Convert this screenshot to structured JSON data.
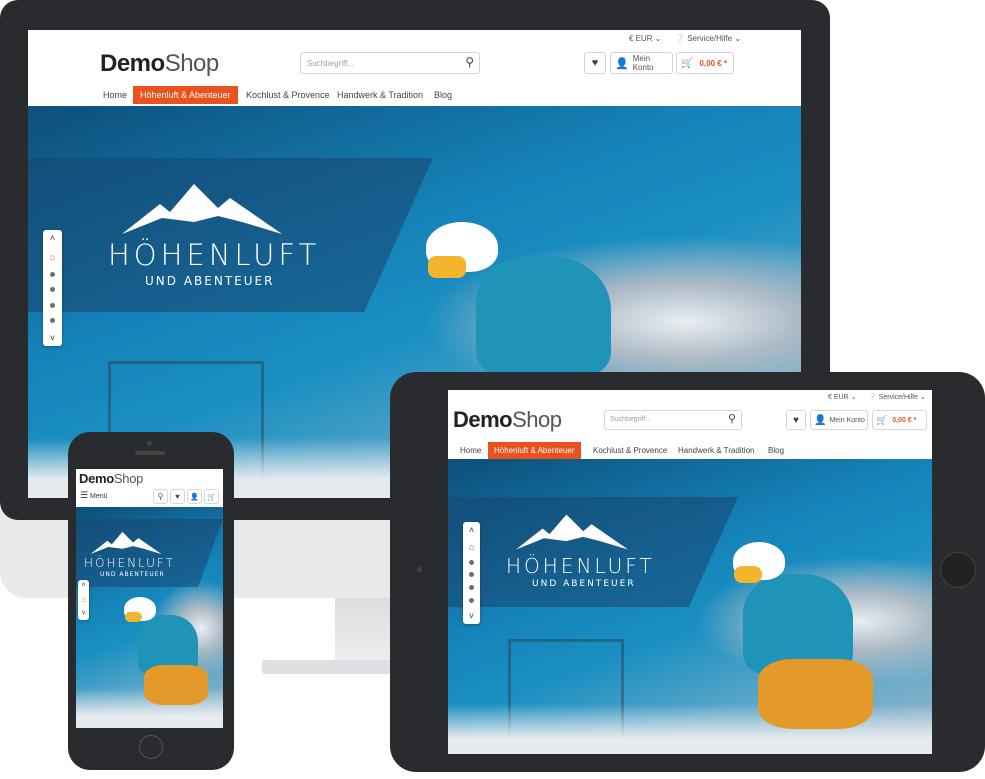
{
  "shop": {
    "logo_demo": "Demo",
    "logo_shop": "Shop",
    "currency": "€ EUR",
    "service": "Service/Hilfe",
    "search_placeholder": "Suchbegriff...",
    "account": "Mein Konto",
    "cart_total": "0,00 € *",
    "menu": "Menü",
    "nav": [
      "Home",
      "Höhenluft & Abenteuer",
      "Kochlust & Provence",
      "Handwerk & Tradition",
      "Blog"
    ],
    "hero_title": "HÖHENLUFT",
    "hero_subtitle": "UND ABENTEUER"
  },
  "icons": {
    "search": "search-icon",
    "heart": "heart-icon",
    "user": "user-icon",
    "cart": "cart-icon",
    "help": "help-circle-icon",
    "chevron_down": "chevron-down-icon",
    "chevron_up": "chevron-up-icon",
    "home": "home-icon",
    "menu": "hamburger-icon",
    "mountain": "mountain-logo-icon"
  },
  "colors": {
    "accent": "#e9511f",
    "frame": "#2a2b2e",
    "hero_blue": "#1583b9"
  }
}
